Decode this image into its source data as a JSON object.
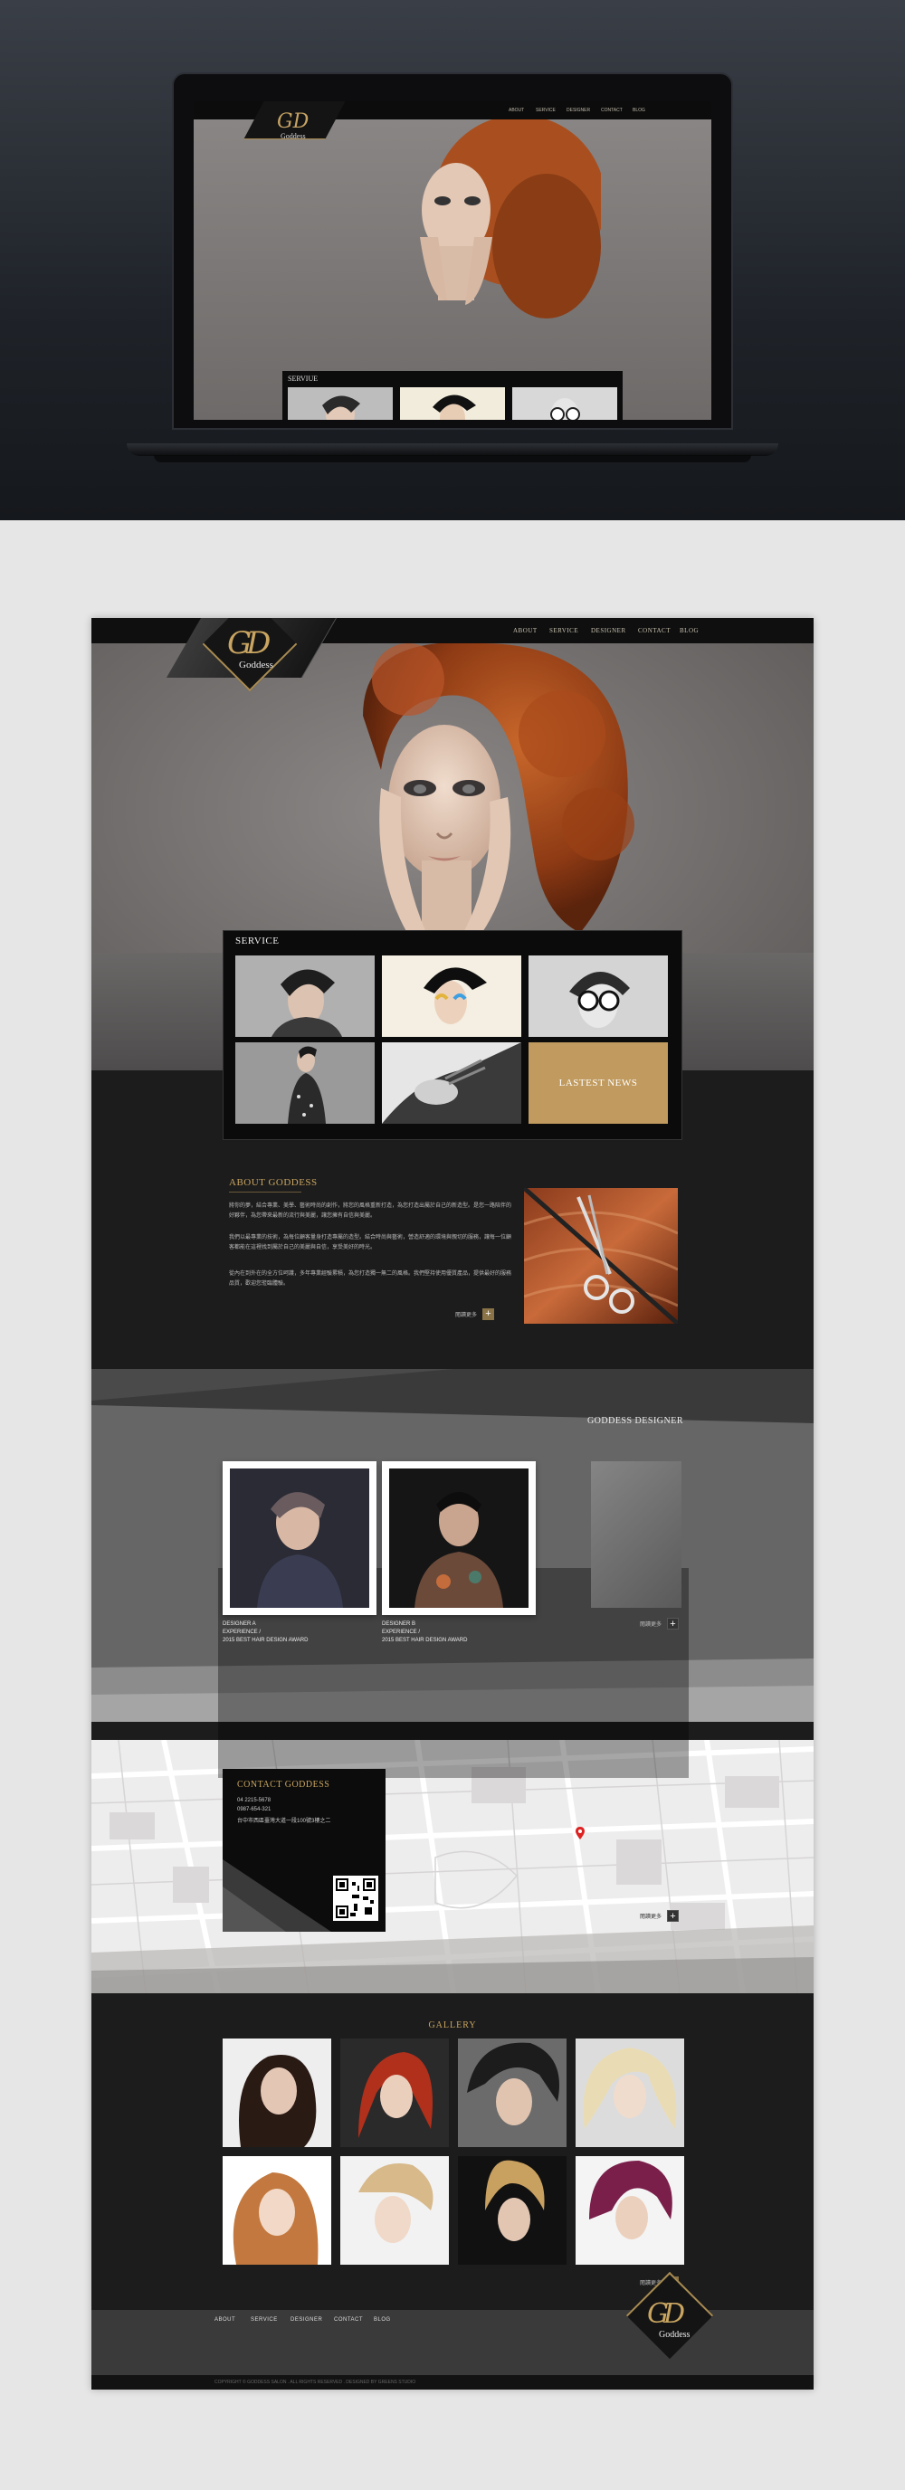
{
  "nav": {
    "items": [
      "ABOUT",
      "SERVICE",
      "DESIGNER",
      "CONTACT",
      "BLOG"
    ]
  },
  "logo": {
    "mark": "GD",
    "text": "Goddess"
  },
  "mini": {
    "service_title": "SERVIUE"
  },
  "service": {
    "title": "SERVICE",
    "news_label": "LASTEST NEWS"
  },
  "about": {
    "title": "ABOUT GODDESS",
    "paragraphs": [
      "將你的夢，結合專業、美學、藝術時尚的創作，將您的風格重新打造，為您打造出屬於自己的新造型。是您一路陪伴的好夥伴，為您帶來最新的流行與美麗，讓您擁有自信與美麗。",
      "我們以最專業的技術，為每位顧客量身打造專屬的造型。結合時尚與藝術，營造舒適的環境與親切的服務，讓每一位顧客都能在這裡找到屬於自己的美麗與自信，享受美好的時光。",
      "從內在到外在的全方位呵護，多年專業經驗累積，為您打造獨一無二的風格。我們堅持使用優質產品，提供最好的服務品質，歡迎您蒞臨體驗。"
    ],
    "more_label": "閱讀更多"
  },
  "designer": {
    "title": "GODDESS DESIGNER",
    "cards": [
      {
        "name": "DESIGNER A",
        "role": "EXPERIENCE /",
        "award": "2015 BEST HAIR DESIGN AWARD"
      },
      {
        "name": "DESIGNER B",
        "role": "EXPERIENCE /",
        "award": "2015 BEST HAIR DESIGN AWARD"
      }
    ],
    "more_label": "閱讀更多"
  },
  "contact": {
    "title": "CONTACT GODDESS",
    "phone": "04 2215-5678",
    "mobile": "0987-654-321",
    "address": "台中市西區臺灣大道一段100號3樓之二",
    "more_label": "閱讀更多"
  },
  "gallery": {
    "title": "GALLERY",
    "more_label": "閱讀更多"
  },
  "footer": {
    "items": [
      "ABOUT",
      "SERVICE",
      "DESIGNER",
      "CONTACT",
      "BLOG"
    ],
    "copyright": "COPYRIGHT © GODDESS SALON . ALL RIGHTS RESERVED . DESIGNED BY GREENS STUDIO"
  },
  "colors": {
    "gold": "#c9a561",
    "news": "#c09a5e",
    "dark": "#1c1c1c"
  }
}
